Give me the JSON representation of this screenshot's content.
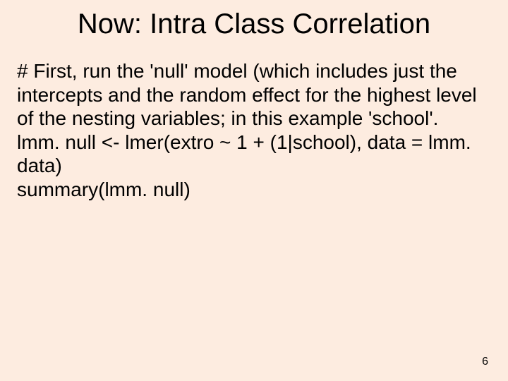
{
  "slide": {
    "title": "Now: Intra Class Correlation",
    "body": "# First, run the 'null' model (which includes just the intercepts and the random effect for the highest level of the nesting variables; in this example 'school'.\nlmm. null <- lmer(extro ~ 1 + (1|school), data = lmm. data)\nsummary(lmm. null)",
    "page_number": "6"
  }
}
